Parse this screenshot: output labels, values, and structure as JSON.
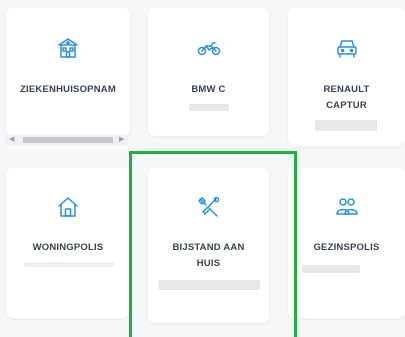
{
  "cards": [
    {
      "label": "ZIEKENHUISOPNAM",
      "icon": "hospital-icon"
    },
    {
      "label": "BMW C",
      "icon": "motorcycle-icon"
    },
    {
      "label": "RENAULT CAPTUR",
      "icon": "car-icon"
    },
    {
      "label": "WONINGPOLIS",
      "icon": "house-icon"
    },
    {
      "label": "BIJSTAND AAN HUIS",
      "icon": "tools-icon"
    },
    {
      "label": "GEZINSPOLIS",
      "icon": "family-icon"
    }
  ],
  "colors": {
    "accent": "#2a8fd9",
    "highlight": "#1fb23a"
  }
}
